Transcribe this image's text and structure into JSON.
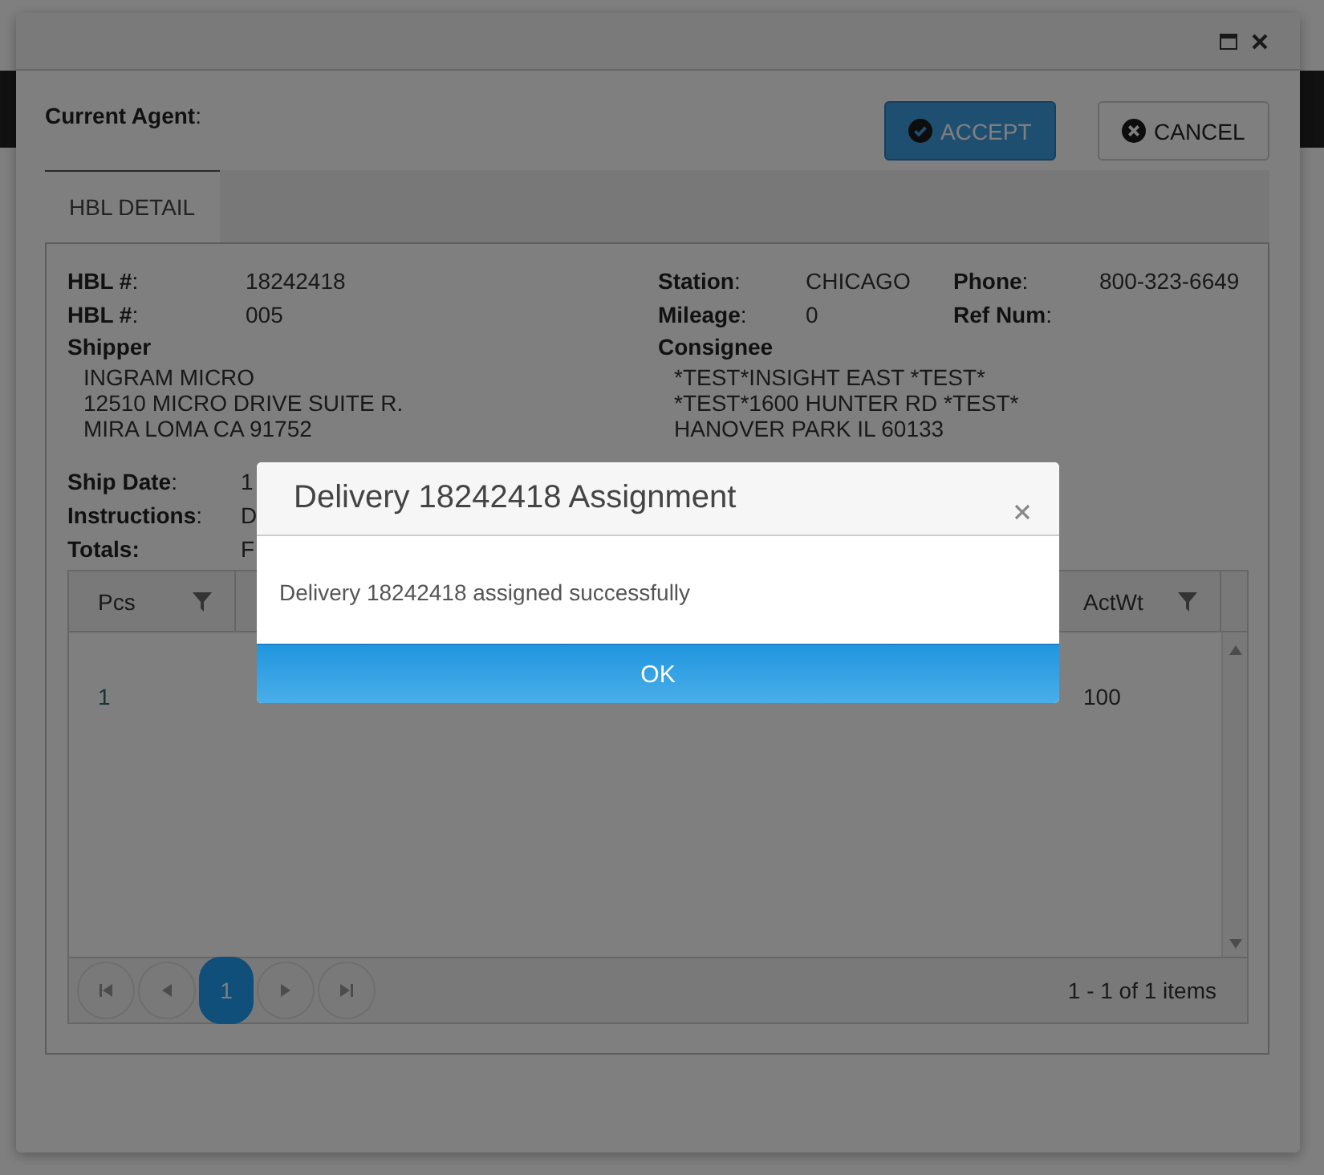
{
  "current_agent": {
    "label": "**Current Agent**:"
  },
  "actions": [
    {
      "kind": "accept",
      "label": "ACCEPT"
    },
    {
      "kind": "cancel",
      "label": "CANCEL"
    }
  ],
  "tabs": [
    {
      "label": "HBL DETAIL",
      "selected": true
    }
  ],
  "detail_rows": [
    [
      {
        "label": "**HBL #**:",
        "value": "18242418"
      },
      {
        "label": "**Station**:",
        "value": "CHICAGO"
      },
      {
        "label": "**Phone**:",
        "value": "800-323-6649"
      }
    ],
    [
      {
        "label": "**HBL #**:",
        "value": "005"
      },
      {
        "label": "**Mileage**:",
        "value": "0"
      },
      {
        "label": "**Ref Num**:"
      }
    ]
  ],
  "shipper": {
    "label": "Shipper",
    "lines": [
      "INGRAM MICRO",
      "12510 MICRO DRIVE SUITE R.",
      "MIRA LOMA CA 91752"
    ]
  },
  "consignee": {
    "label": "Consignee",
    "lines": [
      "*TEST*INSIGHT EAST *TEST*",
      "*TEST*1600 HUNTER RD *TEST*",
      "HANOVER PARK IL 60133"
    ]
  },
  "ship_info": [
    {
      "label": "**Ship Date**:",
      "value": "1"
    },
    {
      "label": "**Instructions**:",
      "value": "D"
    },
    {
      "label": "**Totals:**",
      "value": "F"
    }
  ],
  "grid": {
    "columns": [
      {
        "label": "Pcs"
      },
      {
        "label": "ActWt"
      }
    ],
    "rows": [
      [
        "1",
        "100"
      ]
    ],
    "pages": [
      {
        "label": "1",
        "selected": true
      }
    ],
    "info": "1 - 1 of 1 items"
  },
  "dialog": {
    "title": "Delivery 18242418 Assignment",
    "message": "Delivery 18242418 assigned successfully",
    "button": "OK"
  }
}
